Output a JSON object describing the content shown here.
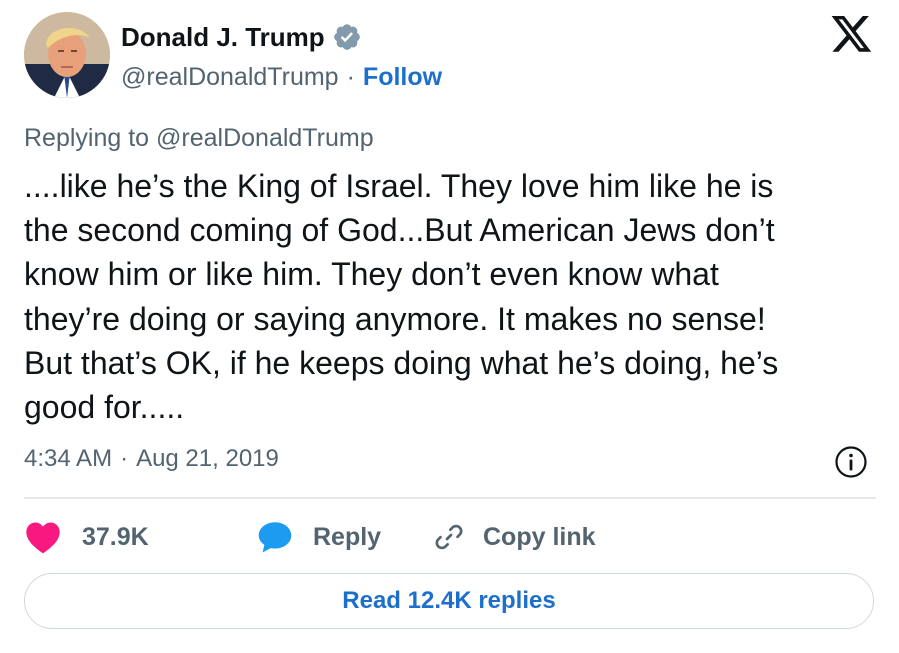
{
  "author": {
    "name": "Donald J. Trump",
    "handle": "@realDonaldTrump",
    "separator": "·",
    "follow_label": "Follow"
  },
  "tweet": {
    "replying_to": "Replying to @realDonaldTrump",
    "lines": [
      "....like he’s the King of Israel. They love him like he is",
      "the second coming of God...But American Jews don’t",
      "know him or like him. They don’t even know what",
      "they’re doing or saying anymore. It makes no sense!",
      "But that’s OK, if he keeps doing what he’s doing, he’s",
      "good for....."
    ],
    "time": "4:34 AM",
    "date_separator": "·",
    "date": "Aug 21, 2019"
  },
  "actions": {
    "like_count": "37.9K",
    "reply_label": "Reply",
    "copy_link_label": "Copy link"
  },
  "footer": {
    "read_replies_label": "Read 12.4K replies"
  },
  "icons": {
    "verified": "verified-badge-icon",
    "x_logo": "x-logo-icon",
    "info": "info-icon",
    "like": "heart-icon",
    "reply": "speech-bubble-icon",
    "copy_link": "link-icon"
  },
  "colors": {
    "accent": "#1d6fce",
    "like": "#f91880",
    "reply_icon": "#1d9bf0",
    "muted_text": "#536471",
    "verified_badge": "#829aab"
  }
}
